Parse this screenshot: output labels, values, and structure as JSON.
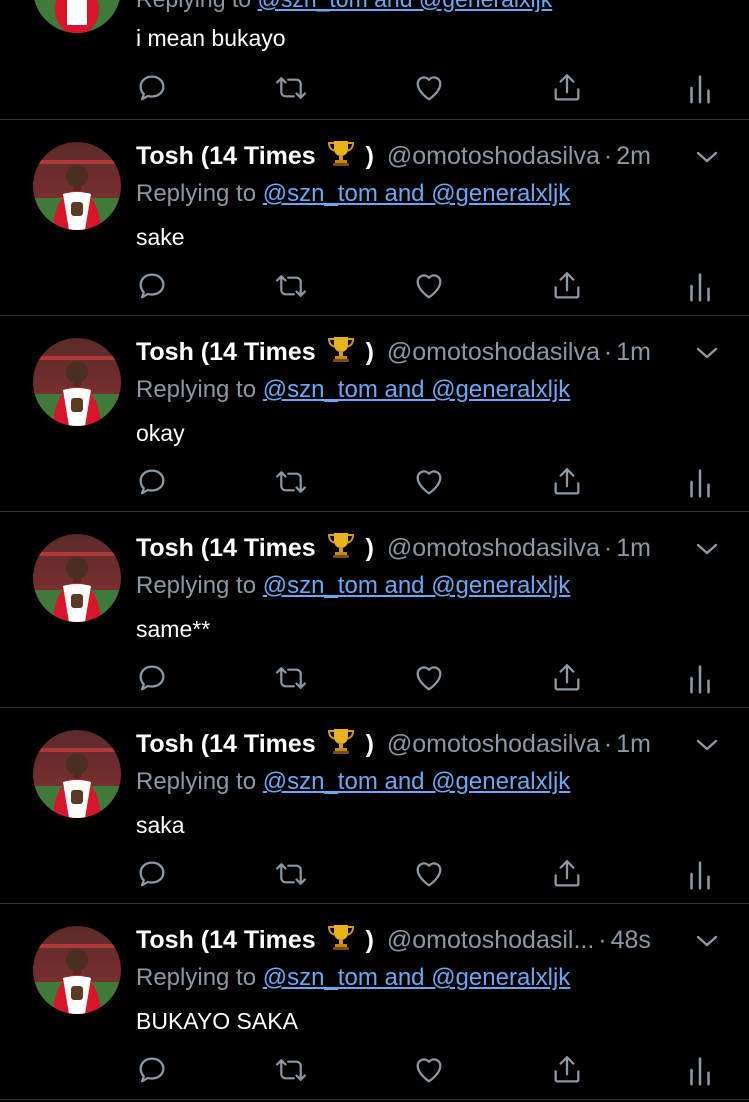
{
  "partial": {
    "reply_prefix": "Replying to",
    "reply_link": "@szn_tom and @generalxljk",
    "text": "i mean bukayo"
  },
  "tweets": [
    {
      "name": "Tosh (14 Times",
      "name_close": ")",
      "handle": "@omotoshodasilva",
      "time": "2m",
      "reply_prefix": "Replying to",
      "reply_link": "@szn_tom and @generalxljk",
      "text": "sake"
    },
    {
      "name": "Tosh (14 Times",
      "name_close": ")",
      "handle": "@omotoshodasilva",
      "time": "1m",
      "reply_prefix": "Replying to",
      "reply_link": "@szn_tom and @generalxljk",
      "text": "okay"
    },
    {
      "name": "Tosh (14 Times",
      "name_close": ")",
      "handle": "@omotoshodasilva",
      "time": "1m",
      "reply_prefix": "Replying to",
      "reply_link": "@szn_tom and @generalxljk",
      "text": "same**"
    },
    {
      "name": "Tosh (14 Times",
      "name_close": ")",
      "handle": "@omotoshodasilva",
      "time": "1m",
      "reply_prefix": "Replying to",
      "reply_link": "@szn_tom and @generalxljk",
      "text": "saka"
    },
    {
      "name": "Tosh (14 Times",
      "name_close": ")",
      "handle": "@omotoshodasil...",
      "time": "48s",
      "reply_prefix": "Replying to",
      "reply_link": "@szn_tom and @generalxljk",
      "text": "BUKAYO SAKA"
    }
  ],
  "separator": "·",
  "icons": {
    "trophy": "trophy-icon",
    "caret": "chevron-down-icon",
    "reply": "reply-icon",
    "retweet": "retweet-icon",
    "like": "heart-icon",
    "share": "share-icon",
    "stats": "analytics-icon"
  },
  "colors": {
    "background": "#000000",
    "text": "#ffffff",
    "muted": "#8b98a5",
    "link": "#6aa9f2",
    "divider": "#2f3336",
    "icon": "#8b98a5"
  }
}
